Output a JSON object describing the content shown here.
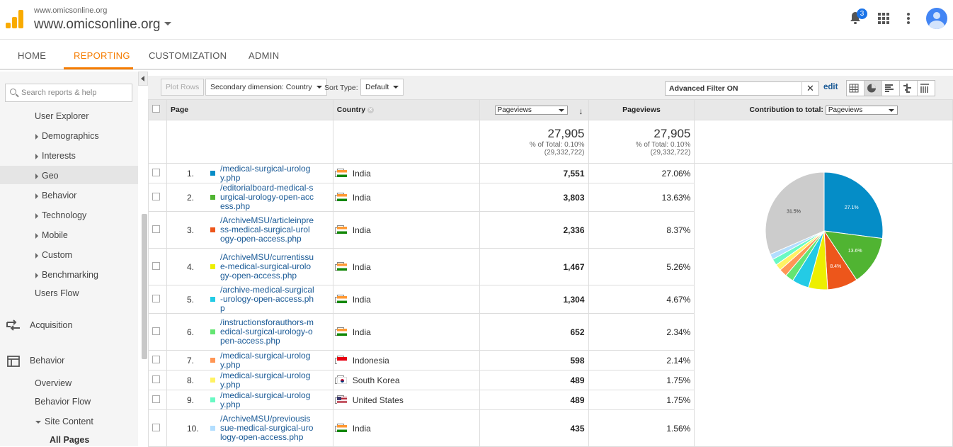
{
  "header": {
    "site_small": "www.omicsonline.org",
    "site_name": "www.omicsonline.org",
    "notification_count": "3"
  },
  "nav": {
    "tabs": [
      "HOME",
      "REPORTING",
      "CUSTOMIZATION",
      "ADMIN"
    ],
    "active": "REPORTING"
  },
  "sidebar": {
    "search_placeholder": "Search reports & help",
    "items": [
      "User Explorer",
      "Demographics",
      "Interests",
      "Geo",
      "Behavior",
      "Technology",
      "Mobile",
      "Custom",
      "Benchmarking",
      "Users Flow"
    ],
    "sections": [
      "Acquisition",
      "Behavior"
    ],
    "behavior_items": [
      "Overview",
      "Behavior Flow",
      "Site Content",
      "All Pages"
    ]
  },
  "toolbar": {
    "plot_rows": "Plot Rows",
    "secondary_dimension": "Secondary dimension: Country",
    "sort_type_label": "Sort Type:",
    "sort_type_value": "Default",
    "filter_text": "Advanced Filter ON",
    "edit": "edit"
  },
  "table": {
    "headers": {
      "page": "Page",
      "country": "Country",
      "metric_select": "Pageviews",
      "metric": "Pageviews",
      "contribution": "Contribution to total:",
      "contribution_select": "Pageviews"
    },
    "totals": {
      "value": "27,905",
      "pct": "% of Total: 0.10%",
      "total": "(29,332,722)"
    },
    "rows": [
      {
        "n": "1.",
        "page": "/medical-surgical-urology.php",
        "country": "India",
        "flag": "in",
        "value": "7,551",
        "pct": "27.06%",
        "color": "#058dc7"
      },
      {
        "n": "2.",
        "page": "/editorialboard-medical-surgical-urology-open-access.php",
        "country": "India",
        "flag": "in",
        "value": "3,803",
        "pct": "13.63%",
        "color": "#50b432"
      },
      {
        "n": "3.",
        "page": "/ArchiveMSU/articleinpress-medical-surgical-urology-open-access.php",
        "country": "India",
        "flag": "in",
        "value": "2,336",
        "pct": "8.37%",
        "color": "#ed561b"
      },
      {
        "n": "4.",
        "page": "/ArchiveMSU/currentissue-medical-surgical-urology-open-access.php",
        "country": "India",
        "flag": "in",
        "value": "1,467",
        "pct": "5.26%",
        "color": "#edef00"
      },
      {
        "n": "5.",
        "page": "/archive-medical-surgical-urology-open-access.php",
        "country": "India",
        "flag": "in",
        "value": "1,304",
        "pct": "4.67%",
        "color": "#24cbe5"
      },
      {
        "n": "6.",
        "page": "/instructionsforauthors-medical-surgical-urology-open-access.php",
        "country": "India",
        "flag": "in",
        "value": "652",
        "pct": "2.34%",
        "color": "#64e572"
      },
      {
        "n": "7.",
        "page": "/medical-surgical-urology.php",
        "country": "Indonesia",
        "flag": "id",
        "value": "598",
        "pct": "2.14%",
        "color": "#ff9655"
      },
      {
        "n": "8.",
        "page": "/medical-surgical-urology.php",
        "country": "South Korea",
        "flag": "kr",
        "value": "489",
        "pct": "1.75%",
        "color": "#fff263"
      },
      {
        "n": "9.",
        "page": "/medical-surgical-urology.php",
        "country": "United States",
        "flag": "us",
        "value": "489",
        "pct": "1.75%",
        "color": "#6af9c4"
      },
      {
        "n": "10.",
        "page": "/ArchiveMSU/previousissue-medical-surgical-urology-open-access.php",
        "country": "India",
        "flag": "in",
        "value": "435",
        "pct": "1.56%",
        "color": "#b2deff"
      }
    ]
  },
  "chart_data": {
    "type": "pie",
    "categories": [
      "1",
      "2",
      "3",
      "4",
      "5",
      "6",
      "7",
      "8",
      "9",
      "10",
      "Other"
    ],
    "values": [
      27.06,
      13.63,
      8.37,
      5.26,
      4.67,
      2.34,
      2.14,
      1.75,
      1.75,
      1.56,
      31.5
    ],
    "colors": [
      "#058dc7",
      "#50b432",
      "#ed561b",
      "#edef00",
      "#24cbe5",
      "#64e572",
      "#ff9655",
      "#fff263",
      "#6af9c4",
      "#b2deff",
      "#cccccc"
    ],
    "data_labels": [
      "27.1%",
      "13.6%",
      "8.4%",
      "",
      "",
      "",
      "",
      "",
      "",
      "",
      "31.5%"
    ]
  }
}
